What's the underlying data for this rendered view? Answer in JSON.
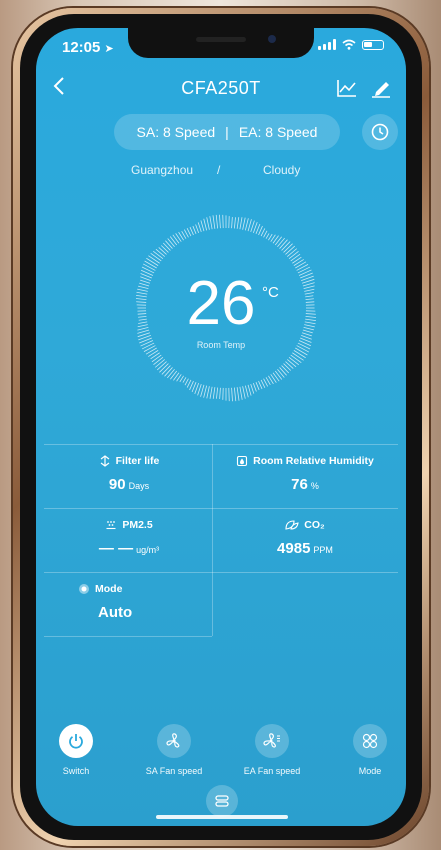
{
  "status": {
    "time": "12:05"
  },
  "header": {
    "title": "CFA250T"
  },
  "speeds": {
    "sa": "SA:  8 Speed",
    "separator": "|",
    "ea": "EA:  8 Speed"
  },
  "location": {
    "city": "Guangzhou",
    "separator": "/",
    "weather": "Cloudy"
  },
  "temperature": {
    "value": "26",
    "unit": "°C",
    "label": "Room Temp"
  },
  "metrics": {
    "filter": {
      "label": "Filter life",
      "value": "90",
      "unit": "Days"
    },
    "humidity": {
      "label": "Room Relative Humidity",
      "value": "76",
      "unit": "%"
    },
    "pm25": {
      "label": "PM2.5",
      "value": "— —",
      "unit": "ug/m³"
    },
    "co2": {
      "label": "CO₂",
      "value": "4985",
      "unit": "PPM"
    },
    "mode": {
      "label": "Mode",
      "value": "Auto"
    }
  },
  "controls": {
    "switch": "Switch",
    "sa_fan": "SA Fan speed",
    "ea_fan": "EA Fan speed",
    "mode": "Mode"
  },
  "colors": {
    "background": "#2aa9dd",
    "switch_icon": "#2aa9dd"
  }
}
